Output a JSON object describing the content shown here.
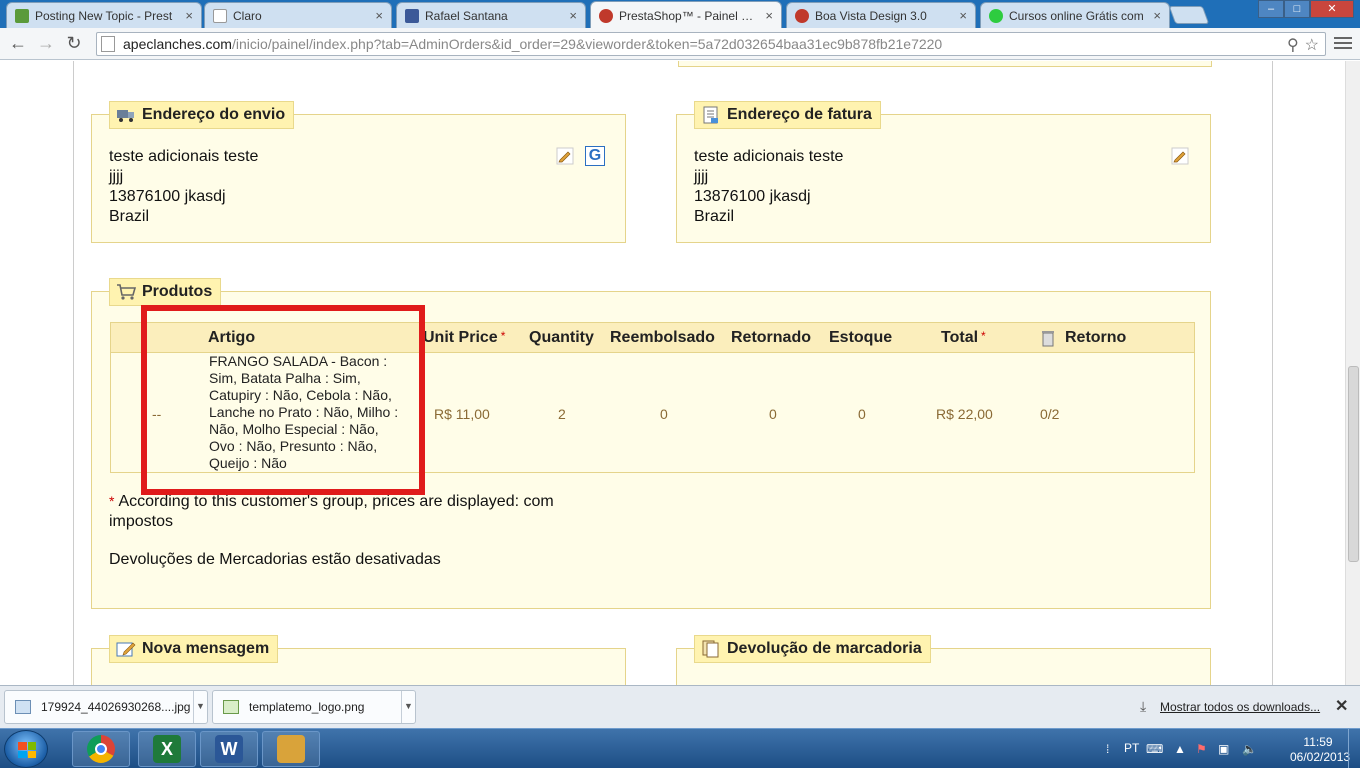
{
  "browser": {
    "tabs": [
      {
        "title": "Posting New Topic - Prest",
        "favicon_color": "#5a9a3a",
        "active": false
      },
      {
        "title": "Claro",
        "favicon_color": "#ffffff",
        "active": false
      },
      {
        "title": "Rafael Santana",
        "favicon_color": "#3b5998",
        "active": false
      },
      {
        "title": "PrestaShop™ - Painel de A",
        "favicon_color": "#c0392b",
        "active": true
      },
      {
        "title": "Boa Vista Design 3.0",
        "favicon_color": "#c0392b",
        "active": false
      },
      {
        "title": "Cursos online Grátis com",
        "favicon_color": "#2ecc40",
        "active": false
      }
    ],
    "tab_close": "×",
    "window_controls": {
      "minimize": "–",
      "maximize": "□",
      "close": "✕"
    },
    "url_host": "apeclanches.com",
    "url_path": "/inicio/painel/index.php?tab=AdminOrders&id_order=29&vieworder&token=5a72d032654baa31ec9b878fb21e7220",
    "back": "←",
    "forward": "→",
    "reload": "↻",
    "zoom_icon": "⚲",
    "star_icon": "☆"
  },
  "shipping": {
    "title": "Endereço do envio",
    "lines": [
      "teste adicionais teste",
      "jjjj",
      "13876100 jkasdj",
      "Brazil"
    ],
    "google_label": "G"
  },
  "invoice": {
    "title": "Endereço de fatura",
    "lines": [
      "teste adicionais teste",
      "jjjj",
      "13876100 jkasdj",
      "Brazil"
    ]
  },
  "products": {
    "title": "Produtos",
    "headers": {
      "article": "Artigo",
      "unit_price": "Unit Price",
      "quantity": "Quantity",
      "refunded": "Reembolsado",
      "returned": "Retornado",
      "stock": "Estoque",
      "total": "Total",
      "return": "Retorno"
    },
    "required_mark": "*",
    "rows": [
      {
        "image": "--",
        "description": "FRANGO SALADA - Bacon : Sim, Batata Palha : Sim, Catupiry : Não, Cebola : Não, Lanche no Prato : Não, Milho : Não, Molho Especial : Não, Ovo : Não, Presunto : Não, Queijo : Não",
        "unit_price": "R$ 11,00",
        "quantity": "2",
        "refunded": "0",
        "returned": "0",
        "stock": "0",
        "total": "R$ 22,00",
        "return": "0/2"
      }
    ],
    "note": "According to this customer's group, prices are displayed: com impostos",
    "returns_note": "Devoluções de Mercadorias estão desativadas"
  },
  "message": {
    "title": "Nova mensagem"
  },
  "merchandise_return": {
    "title": "Devolução de marcadoria"
  },
  "downloads": {
    "items": [
      {
        "name": "179924_44026930268....jpg"
      },
      {
        "name": "templatemo_logo.png"
      }
    ],
    "show_all": "Mostrar todos os downloads...",
    "close": "✕"
  },
  "taskbar": {
    "apps": [
      {
        "name": "chrome",
        "label": "",
        "color": "#e8e8e8"
      },
      {
        "name": "excel",
        "label": "X",
        "color": "#1f7a3a"
      },
      {
        "name": "word",
        "label": "W",
        "color": "#2b5797"
      },
      {
        "name": "paint",
        "label": "🎨",
        "color": "#d9a33a"
      }
    ],
    "language": "PT",
    "time": "11:59",
    "date": "06/02/2013"
  },
  "colors": {
    "panel_bg": "#fffde8",
    "panel_border": "#e5d48b",
    "legend_bg": "#fff3b0",
    "highlight_red": "#e01b1b",
    "price_text": "#8a6a35"
  }
}
